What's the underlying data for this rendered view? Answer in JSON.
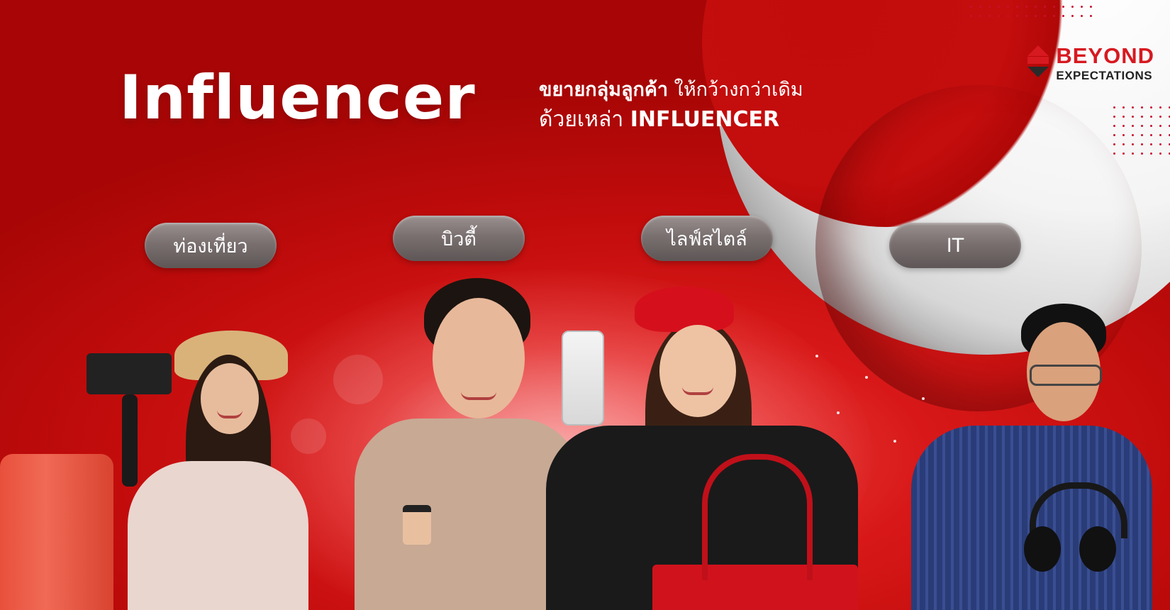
{
  "hero": {
    "title": "Influencer",
    "tagline_line1_bold": "ขยายกลุ่มลูกค้า",
    "tagline_line1_rest": " ให้กว้างกว่าเดิม",
    "tagline_line2_rest": "ด้วยเหล่า ",
    "tagline_line2_bold": "INFLUENCER"
  },
  "brand": {
    "line1": "BEYOND",
    "line2": "EXPECTATIONS",
    "accent_color": "#d71920"
  },
  "categories": [
    {
      "label": "ท่องเที่ยว",
      "icon": "camera-vlogger"
    },
    {
      "label": "บิวตี้",
      "icon": "beauty-model"
    },
    {
      "label": "ไลฟ์สไตล์",
      "icon": "lifestyle-selfie"
    },
    {
      "label": "IT",
      "icon": "tech-headphones"
    }
  ],
  "theme": {
    "background_red": "#c20c0c",
    "pill_gray": "#7a7070",
    "text_white": "#ffffff"
  }
}
